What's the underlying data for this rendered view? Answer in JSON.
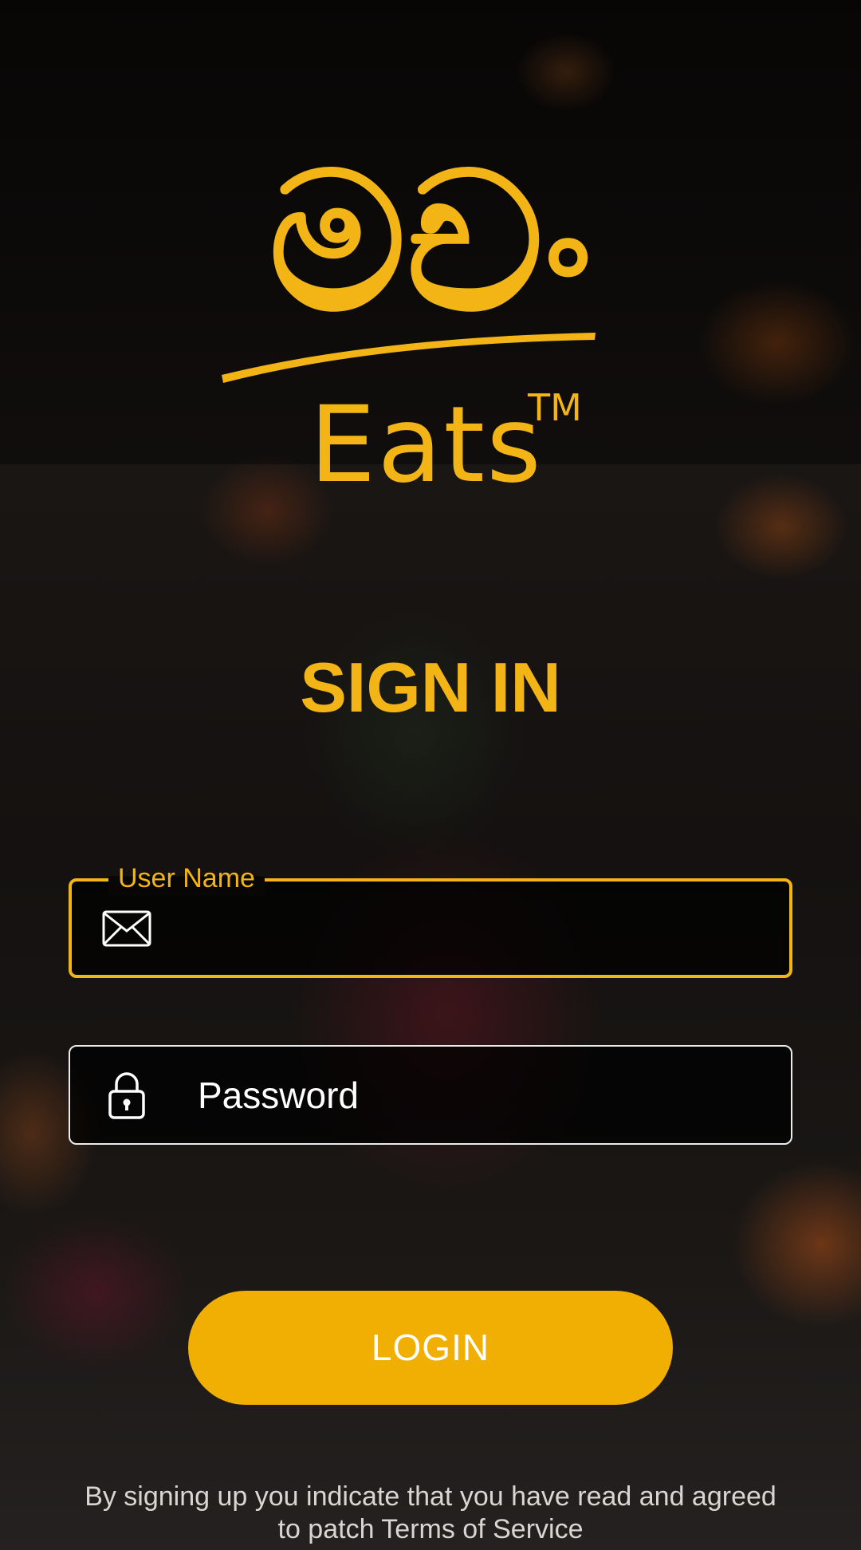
{
  "app": {
    "logo_script": "මචං",
    "logo_word": "Eats",
    "trademark": "TM"
  },
  "screen": {
    "title": "SIGN IN"
  },
  "form": {
    "username": {
      "label": "User Name",
      "value": "",
      "icon": "envelope-icon"
    },
    "password": {
      "placeholder": "Password",
      "value": "",
      "icon": "lock-icon"
    },
    "login_label": "LOGIN"
  },
  "footer": {
    "terms_text": "By signing up you indicate that you have read and agreed to patch Terms of Service"
  },
  "colors": {
    "accent": "#F2B515",
    "button": "#F0AF02",
    "text": "#FFFFFF"
  }
}
